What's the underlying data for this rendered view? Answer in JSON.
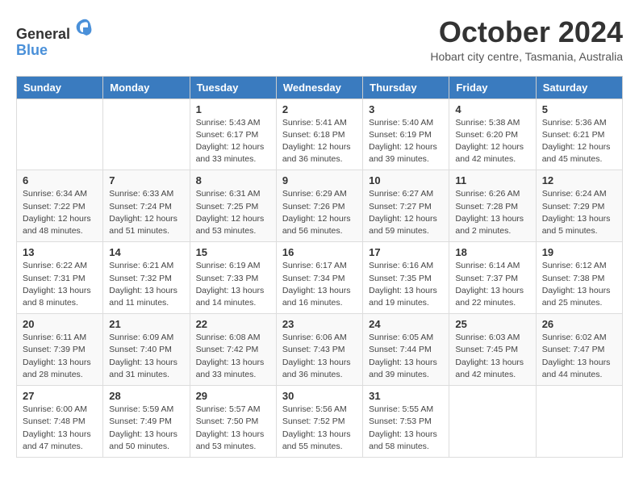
{
  "header": {
    "logo_general": "General",
    "logo_blue": "Blue",
    "month": "October 2024",
    "location": "Hobart city centre, Tasmania, Australia"
  },
  "days_of_week": [
    "Sunday",
    "Monday",
    "Tuesday",
    "Wednesday",
    "Thursday",
    "Friday",
    "Saturday"
  ],
  "weeks": [
    [
      {
        "day": "",
        "info": ""
      },
      {
        "day": "",
        "info": ""
      },
      {
        "day": "1",
        "info": "Sunrise: 5:43 AM\nSunset: 6:17 PM\nDaylight: 12 hours and 33 minutes."
      },
      {
        "day": "2",
        "info": "Sunrise: 5:41 AM\nSunset: 6:18 PM\nDaylight: 12 hours and 36 minutes."
      },
      {
        "day": "3",
        "info": "Sunrise: 5:40 AM\nSunset: 6:19 PM\nDaylight: 12 hours and 39 minutes."
      },
      {
        "day": "4",
        "info": "Sunrise: 5:38 AM\nSunset: 6:20 PM\nDaylight: 12 hours and 42 minutes."
      },
      {
        "day": "5",
        "info": "Sunrise: 5:36 AM\nSunset: 6:21 PM\nDaylight: 12 hours and 45 minutes."
      }
    ],
    [
      {
        "day": "6",
        "info": "Sunrise: 6:34 AM\nSunset: 7:22 PM\nDaylight: 12 hours and 48 minutes."
      },
      {
        "day": "7",
        "info": "Sunrise: 6:33 AM\nSunset: 7:24 PM\nDaylight: 12 hours and 51 minutes."
      },
      {
        "day": "8",
        "info": "Sunrise: 6:31 AM\nSunset: 7:25 PM\nDaylight: 12 hours and 53 minutes."
      },
      {
        "day": "9",
        "info": "Sunrise: 6:29 AM\nSunset: 7:26 PM\nDaylight: 12 hours and 56 minutes."
      },
      {
        "day": "10",
        "info": "Sunrise: 6:27 AM\nSunset: 7:27 PM\nDaylight: 12 hours and 59 minutes."
      },
      {
        "day": "11",
        "info": "Sunrise: 6:26 AM\nSunset: 7:28 PM\nDaylight: 13 hours and 2 minutes."
      },
      {
        "day": "12",
        "info": "Sunrise: 6:24 AM\nSunset: 7:29 PM\nDaylight: 13 hours and 5 minutes."
      }
    ],
    [
      {
        "day": "13",
        "info": "Sunrise: 6:22 AM\nSunset: 7:31 PM\nDaylight: 13 hours and 8 minutes."
      },
      {
        "day": "14",
        "info": "Sunrise: 6:21 AM\nSunset: 7:32 PM\nDaylight: 13 hours and 11 minutes."
      },
      {
        "day": "15",
        "info": "Sunrise: 6:19 AM\nSunset: 7:33 PM\nDaylight: 13 hours and 14 minutes."
      },
      {
        "day": "16",
        "info": "Sunrise: 6:17 AM\nSunset: 7:34 PM\nDaylight: 13 hours and 16 minutes."
      },
      {
        "day": "17",
        "info": "Sunrise: 6:16 AM\nSunset: 7:35 PM\nDaylight: 13 hours and 19 minutes."
      },
      {
        "day": "18",
        "info": "Sunrise: 6:14 AM\nSunset: 7:37 PM\nDaylight: 13 hours and 22 minutes."
      },
      {
        "day": "19",
        "info": "Sunrise: 6:12 AM\nSunset: 7:38 PM\nDaylight: 13 hours and 25 minutes."
      }
    ],
    [
      {
        "day": "20",
        "info": "Sunrise: 6:11 AM\nSunset: 7:39 PM\nDaylight: 13 hours and 28 minutes."
      },
      {
        "day": "21",
        "info": "Sunrise: 6:09 AM\nSunset: 7:40 PM\nDaylight: 13 hours and 31 minutes."
      },
      {
        "day": "22",
        "info": "Sunrise: 6:08 AM\nSunset: 7:42 PM\nDaylight: 13 hours and 33 minutes."
      },
      {
        "day": "23",
        "info": "Sunrise: 6:06 AM\nSunset: 7:43 PM\nDaylight: 13 hours and 36 minutes."
      },
      {
        "day": "24",
        "info": "Sunrise: 6:05 AM\nSunset: 7:44 PM\nDaylight: 13 hours and 39 minutes."
      },
      {
        "day": "25",
        "info": "Sunrise: 6:03 AM\nSunset: 7:45 PM\nDaylight: 13 hours and 42 minutes."
      },
      {
        "day": "26",
        "info": "Sunrise: 6:02 AM\nSunset: 7:47 PM\nDaylight: 13 hours and 44 minutes."
      }
    ],
    [
      {
        "day": "27",
        "info": "Sunrise: 6:00 AM\nSunset: 7:48 PM\nDaylight: 13 hours and 47 minutes."
      },
      {
        "day": "28",
        "info": "Sunrise: 5:59 AM\nSunset: 7:49 PM\nDaylight: 13 hours and 50 minutes."
      },
      {
        "day": "29",
        "info": "Sunrise: 5:57 AM\nSunset: 7:50 PM\nDaylight: 13 hours and 53 minutes."
      },
      {
        "day": "30",
        "info": "Sunrise: 5:56 AM\nSunset: 7:52 PM\nDaylight: 13 hours and 55 minutes."
      },
      {
        "day": "31",
        "info": "Sunrise: 5:55 AM\nSunset: 7:53 PM\nDaylight: 13 hours and 58 minutes."
      },
      {
        "day": "",
        "info": ""
      },
      {
        "day": "",
        "info": ""
      }
    ]
  ]
}
